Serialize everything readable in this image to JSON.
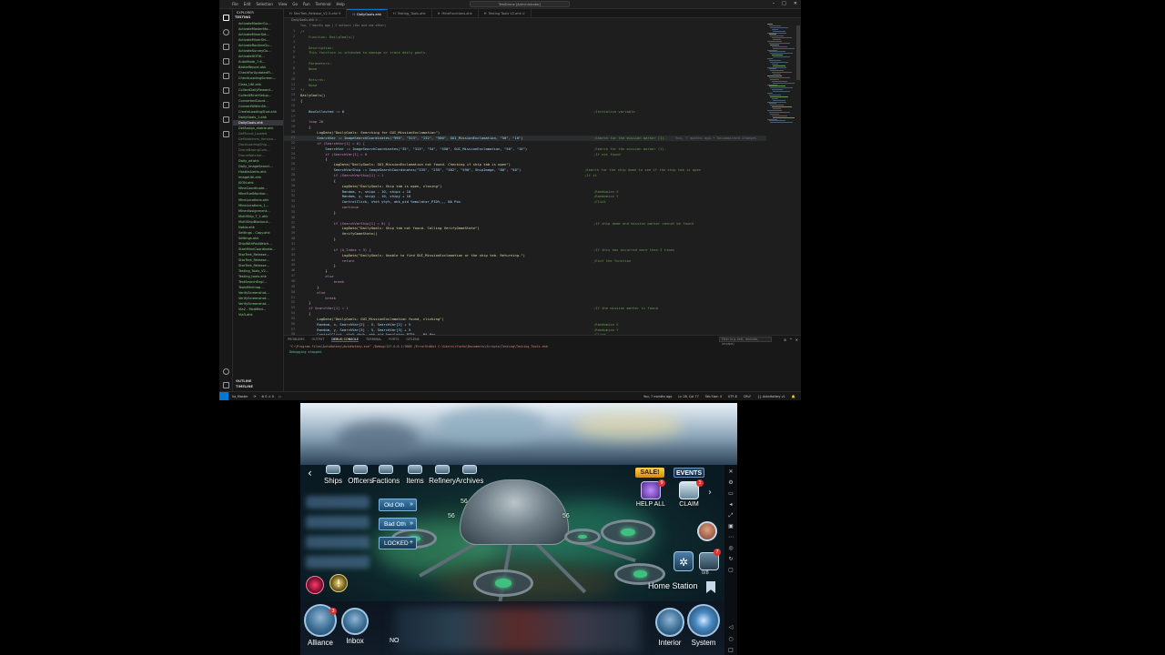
{
  "vscode": {
    "title_bar": {
      "menu": [
        "File",
        "Edit",
        "Selection",
        "View",
        "Go",
        "Run",
        "Terminal",
        "Help"
      ],
      "window_title": "TestDrone [Administrator]"
    },
    "explorer": {
      "header": "EXPLORER",
      "section": "TESTING",
      "files": [
        "ActivateMasterGu...",
        "ActivateMasterMo...",
        "ActivateMinerSet...",
        "ActivateMinerShi...",
        "ActivateRoutineGu...",
        "ActivateSurveyGu...",
        "ActivateXOTIK...",
        "AutoMode_7.6...",
        "BattleReport.ahk",
        "CheckForUpdatedFl...",
        "CheckLoadingScreen...",
        "Class_Util.ahk",
        "CollectDailyReward...",
        "CollectMinerSetup...",
        "ConvertedCoord...",
        "ConvertWithinSh...",
        "CreateLoadingShot.ahk",
        "DailyGoals_1.ahk",
        "DailyGoals.ahk",
        "DefAssign_stable.ahk",
        "DefScout_Loaded",
        "DefWatchers_Version...",
        "DockLoadingShip...",
        "DroneBasingCom...",
        "DroneWatcher...",
        "Daily_wf.ahk",
        "Daily_ImageSearch...",
        "HostileAlerts.ahk",
        "ImageUtil.ahk",
        "JSON.ahk",
        "MineCoordinate...",
        "MineFuelMonitor...",
        "MineLocations.ahk",
        "MineLocations_1...",
        "MinerAssignment...",
        "MultiShip_T_1.ahk",
        "MultiShipBlockout...",
        "Nokia.ahk",
        "Settings - Copy.ahk",
        "Settings.ahk",
        "ShipWithPosWatch...",
        "StartMineCoordinate...",
        "StarTrek_Release...",
        "StarTrek_Release...",
        "StarTrek_Release...",
        "Testing_Tools_V2...",
        "Testing_tools.ahk",
        "TextSearchEngi...",
        "ToolsMinimap...",
        "VerifyScreenshot...",
        "VerifyScreenshot...",
        "VerifyScreenshot...",
        "Via2 - Modified...",
        "Via3.ahk"
      ],
      "outline": "OUTLINE",
      "timeline": "TIMELINE"
    },
    "tabs": [
      "StarTrek_Release_V2.5.ahk 9",
      "DailyGoals.ahk",
      "Testing_Tools.ahk",
      "MineFunctions.ahk",
      "Testing Tools V2.ahk U"
    ],
    "breadcrumb": "DailyGoals.ahk > ...",
    "blame": "You, 7 months ago | 2 authors (You and one other)",
    "code_lines": [
      {
        "n": "1",
        "t": "/*",
        "cls": "c-comment"
      },
      {
        "n": "2",
        "t": "    Function: DailyGoals()",
        "cls": "c-comment"
      },
      {
        "n": "3",
        "t": "",
        "cls": ""
      },
      {
        "n": "4",
        "t": "    Description:",
        "cls": "c-comment"
      },
      {
        "n": "5",
        "t": "    This function is intended to manage or track daily goals.",
        "cls": "c-comment"
      },
      {
        "n": "6",
        "t": "",
        "cls": ""
      },
      {
        "n": "7",
        "t": "    Parameters:",
        "cls": "c-comment"
      },
      {
        "n": "8",
        "t": "    None",
        "cls": "c-comment"
      },
      {
        "n": "9",
        "t": "",
        "cls": ""
      },
      {
        "n": "10",
        "t": "    Returns:",
        "cls": "c-comment"
      },
      {
        "n": "11",
        "t": "    None",
        "cls": "c-comment"
      },
      {
        "n": "12",
        "t": "*/",
        "cls": "c-comment"
      },
      {
        "n": "13",
        "t": "DailyGoals()",
        "cls": "c-fn"
      },
      {
        "n": "14",
        "t": "{",
        "cls": ""
      },
      {
        "n": "15",
        "t": "",
        "cls": ""
      },
      {
        "n": "16",
        "t": "    BoxCollected := 0",
        "cls": "c-var"
      },
      {
        "n": "17",
        "t": "",
        "cls": ""
      },
      {
        "n": "18",
        "t": "    loop 20",
        "cls": "c-kw"
      },
      {
        "n": "19",
        "t": "    {",
        "cls": ""
      },
      {
        "n": "20",
        "t": "        LogData(\"DailyGoals: Searching for GUI_MissionExclamation\")",
        "cls": "c-fn"
      },
      {
        "n": "21",
        "t": "        SearchVar := ImageSearchCoordinates(\"990\", \"313\", \"132\", \"500\", GUI_MissionExclamation, \"50\", \"10\")",
        "cls": "c-var"
      },
      {
        "n": "22",
        "t": "        if (SearchVar[1] = 0) {",
        "cls": "c-kw"
      },
      {
        "n": "23",
        "t": "            SearchVar := ImageSearchCoordinates(\"35\", \"313\", \"54\", \"550\", GUI_MissionExclamation, \"50\", \"10\")",
        "cls": "c-var"
      },
      {
        "n": "24",
        "t": "            if (SearchVar[1] = 0",
        "cls": "c-kw"
      },
      {
        "n": "25",
        "t": "            {",
        "cls": ""
      },
      {
        "n": "26",
        "t": "                LogData(\"DailyGoals: GUI_MissionExclamation not found. Checking if ship tab is open\")",
        "cls": "c-fn"
      },
      {
        "n": "27",
        "t": "                SearchVarShip := ImageSearchCoordinates(\"335\", \"255\", \"302\", \"590\", ShipImage, \"80\", \"50\")",
        "cls": "c-var"
      },
      {
        "n": "28",
        "t": "                if (SearchVarShip[1] = 1",
        "cls": "c-kw"
      },
      {
        "n": "29",
        "t": "                {",
        "cls": ""
      },
      {
        "n": "30",
        "t": "                    LogData(\"DailyGoals: Ship tab is open, closing\")",
        "cls": "c-fn"
      },
      {
        "n": "31",
        "t": "                    Random, x, shipx - 10, shipx + 10",
        "cls": "c-var"
      },
      {
        "n": "32",
        "t": "                    Random, y, shipy - 10, shipy + 10",
        "cls": "c-var"
      },
      {
        "n": "33",
        "t": "                    ControlClick, x%x% y%y%, ahk_pid %emulator_PID%,,, NA Pos",
        "cls": "c-var"
      },
      {
        "n": "34",
        "t": "                    continue",
        "cls": "c-kw"
      },
      {
        "n": "35",
        "t": "                }",
        "cls": ""
      },
      {
        "n": "36",
        "t": "",
        "cls": ""
      },
      {
        "n": "37",
        "t": "                if (SearchVarShip[1] = 0) {",
        "cls": "c-kw"
      },
      {
        "n": "38",
        "t": "                    LogData(\"DailyGoals: Ship tab not found. Calling VerifyGameState\")",
        "cls": "c-fn"
      },
      {
        "n": "39",
        "t": "                    VerifyGameState()",
        "cls": "c-fn"
      },
      {
        "n": "40",
        "t": "                }",
        "cls": ""
      },
      {
        "n": "41",
        "t": "",
        "cls": ""
      },
      {
        "n": "42",
        "t": "                if (A_Index > 3) {",
        "cls": "c-kw"
      },
      {
        "n": "43",
        "t": "                    LogData(\"DailyGoals: Unable to find GUI_MissionExclamation or the ship tab. Returning.\")",
        "cls": "c-fn"
      },
      {
        "n": "44",
        "t": "                    return",
        "cls": "c-kw"
      },
      {
        "n": "45",
        "t": "                }",
        "cls": ""
      },
      {
        "n": "46",
        "t": "            }",
        "cls": ""
      },
      {
        "n": "47",
        "t": "            else",
        "cls": "c-kw"
      },
      {
        "n": "48",
        "t": "                break",
        "cls": "c-kw"
      },
      {
        "n": "49",
        "t": "        }",
        "cls": ""
      },
      {
        "n": "50",
        "t": "        else",
        "cls": "c-kw"
      },
      {
        "n": "51",
        "t": "            break",
        "cls": "c-kw"
      },
      {
        "n": "52",
        "t": "    }",
        "cls": ""
      },
      {
        "n": "53",
        "t": "    if SearchVar[1] = 1",
        "cls": "c-kw"
      },
      {
        "n": "54",
        "t": "    {",
        "cls": ""
      },
      {
        "n": "55",
        "t": "        LogData(\"DailyGoals: GUI_MissionExclamation found, clicking\")",
        "cls": "c-fn"
      },
      {
        "n": "56",
        "t": "        Random, x, SearchVar[2] - 5, SearchVar[2] + 5",
        "cls": "c-var"
      },
      {
        "n": "57",
        "t": "        Random, y, SearchVar[3] - 5, SearchVar[3] + 5",
        "cls": "c-var"
      },
      {
        "n": "58",
        "t": "        ControlClick, x%x% y%y%, ahk_pid %emulator_PID%,,, NA Pos",
        "cls": "c-var"
      }
    ],
    "right_comments": [
      {
        "line": "16",
        "t": ";Initialize variable"
      },
      {
        "line": "21",
        "t": ";Search for the mission marker (1)."
      },
      {
        "line": "23",
        "t": ";Search for the mission marker (1)."
      },
      {
        "line": "24",
        "t": ";If not found"
      },
      {
        "line": "27",
        "t": ";Search for the ship dome to see if the ship tab is open"
      },
      {
        "line": "28",
        "t": ";If it"
      },
      {
        "line": "31",
        "t": ";Randomize X"
      },
      {
        "line": "32",
        "t": ";Randomize Y"
      },
      {
        "line": "33",
        "t": ";Click"
      },
      {
        "line": "37",
        "t": ";If ship dome and mission marker cannot be found"
      },
      {
        "line": "42",
        "t": ";If this has occurred more than 3 times"
      },
      {
        "line": "44",
        "t": ";Exit the function"
      },
      {
        "line": "53",
        "t": ";If the mission marker is found"
      },
      {
        "line": "56",
        "t": ";Randomize X"
      },
      {
        "line": "57",
        "t": ";Randomize Y"
      },
      {
        "line": "58",
        "t": ";Click"
      }
    ],
    "inline_blame": "You, 7 months ago • Uncommitted changes",
    "panel": {
      "tabs": [
        "PROBLEMS",
        "OUTPUT",
        "DEBUG CONSOLE",
        "TERMINAL",
        "PORTS",
        "GITLENS"
      ],
      "active_tab": "DEBUG CONSOLE",
      "filter_placeholder": "Filter (e.g. text, !exclude, \\escape)",
      "lines": [
        "\"C:\\Program Files\\AutoHotkey\\AutoHotkey.exe\" /Debug=127.0.0.1:9005 /ErrorStdOut C:\\Users\\rfuchs\\Documents\\Scripts\\Testing\\Testing_Tools.ahk",
        "Debugging stopped."
      ]
    },
    "statusbar": {
      "branch": "ha_Master",
      "sync": "⟳",
      "problems": "⊗ 0  ⚠ 0",
      "debug": "▷",
      "right_items": [
        "You, 7 months ago",
        "Ln 28, Col 77",
        "Tab Size: 4",
        "UTF-8",
        "CRLF",
        "{} AutoHotkey v1",
        "🔔"
      ]
    }
  },
  "game": {
    "nav": [
      "Ships",
      "Officers",
      "Factions",
      "Items",
      "Refinery",
      "Archives"
    ],
    "ship_buttons": [
      "Old Oth",
      "Bad Oth",
      "LOCKED"
    ],
    "level_labels": [
      "56",
      "56",
      "56"
    ],
    "promos": {
      "sale": "SALE!",
      "events": "EVENTS"
    },
    "help_all": {
      "label": "HELP ALL",
      "badge": "9"
    },
    "claim": {
      "label": "CLAIM",
      "badge": "1"
    },
    "alliance_badge": "7",
    "counter": "0/8",
    "location": "Home Station",
    "bottom": {
      "alliance": {
        "label": "Alliance",
        "badge": "3"
      },
      "inbox": {
        "label": "Inbox"
      },
      "interior": {
        "label": "Interior"
      },
      "system": {
        "label": "System"
      },
      "partial": "NO"
    }
  }
}
